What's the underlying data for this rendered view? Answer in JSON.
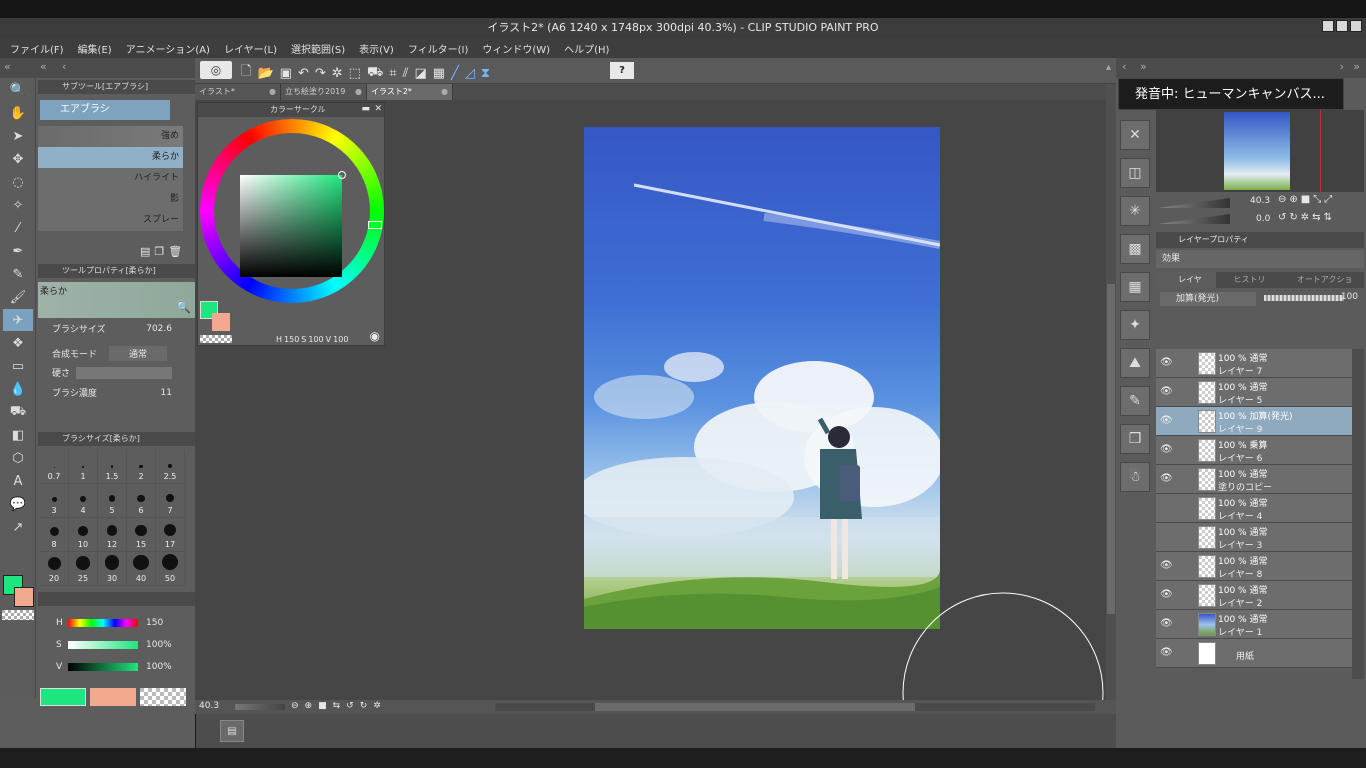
{
  "window": {
    "title": "イラスト2* (A6 1240 x 1748px 300dpi 40.3%) - CLIP STUDIO PAINT PRO"
  },
  "menu": [
    "ファイル(F)",
    "編集(E)",
    "アニメーション(A)",
    "レイヤー(L)",
    "選択範囲(S)",
    "表示(V)",
    "フィルター(I)",
    "ウィンドウ(W)",
    "ヘルプ(H)"
  ],
  "tabs": [
    {
      "label": "イラスト*",
      "active": false
    },
    {
      "label": "立ち絵塗り2019",
      "active": false
    },
    {
      "label": "イラスト2*",
      "active": true
    }
  ],
  "subtool": {
    "header": "サブツール[エアブラシ]",
    "group": "エアブラシ",
    "items": [
      "強め",
      "柔らか",
      "ハイライト",
      "影",
      "スプレー"
    ],
    "selected": "柔らか"
  },
  "tool_property": {
    "header": "ツールプロパティ[柔らか]",
    "preview_label": "柔らか",
    "brush_size_label": "ブラシサイズ",
    "brush_size_value": "702.6",
    "blend_mode_label": "合成モード",
    "blend_mode_value": "通常",
    "hardness_label": "硬さ",
    "density_label": "ブラシ濃度",
    "density_value": "11"
  },
  "brush_size_panel": {
    "header": "ブラシサイズ[柔らか]",
    "sizes": [
      "0.7",
      "1",
      "1.5",
      "2",
      "2.5",
      "3",
      "4",
      "5",
      "6",
      "7",
      "8",
      "10",
      "12",
      "15",
      "17",
      "20",
      "25",
      "30",
      "40",
      "50"
    ]
  },
  "color_circle": {
    "header": "カラーサークル",
    "h_label": "H",
    "h": "150",
    "s_label": "S",
    "s": "100",
    "v_label": "V",
    "v": "100",
    "main_color": "#1ee67e",
    "sub_color": "#f2a98e"
  },
  "hsv_panel": {
    "H": "150",
    "S": "100%",
    "V": "100%"
  },
  "canvas": {
    "zoom": "40.3"
  },
  "navigator": {
    "zoom": "40.3",
    "angle": "0.0"
  },
  "popup": {
    "text": "発音中: ヒューマンキャンバス..."
  },
  "layer_property": {
    "tab": "レイヤープロパティ",
    "effect_label": "効果"
  },
  "layer_panel": {
    "tabs": [
      "レイヤー",
      "ヒストリー",
      "オートアクション"
    ],
    "blend": "加算(発光)",
    "opacity": "100",
    "layers": [
      {
        "mode": "100 % 通常",
        "name": "レイヤー 7",
        "visible": true,
        "selected": false
      },
      {
        "mode": "100 % 通常",
        "name": "レイヤー 5",
        "visible": true,
        "selected": false
      },
      {
        "mode": "100 % 加算(発光)",
        "name": "レイヤー 9",
        "visible": true,
        "selected": true
      },
      {
        "mode": "100 % 乗算",
        "name": "レイヤー 6",
        "visible": true,
        "selected": false
      },
      {
        "mode": "100 % 通常",
        "name": "塗りのコピー",
        "visible": true,
        "selected": false
      },
      {
        "mode": "100 % 通常",
        "name": "レイヤー 4",
        "visible": false,
        "selected": false
      },
      {
        "mode": "100 % 通常",
        "name": "レイヤー 3",
        "visible": false,
        "selected": false
      },
      {
        "mode": "100 % 通常",
        "name": "レイヤー 8",
        "visible": true,
        "selected": false
      },
      {
        "mode": "100 % 通常",
        "name": "レイヤー 2",
        "visible": true,
        "selected": false
      },
      {
        "mode": "100 % 通常",
        "name": "レイヤー 1",
        "visible": true,
        "selected": false
      },
      {
        "mode": "",
        "name": "用紙",
        "visible": true,
        "selected": false
      }
    ]
  }
}
